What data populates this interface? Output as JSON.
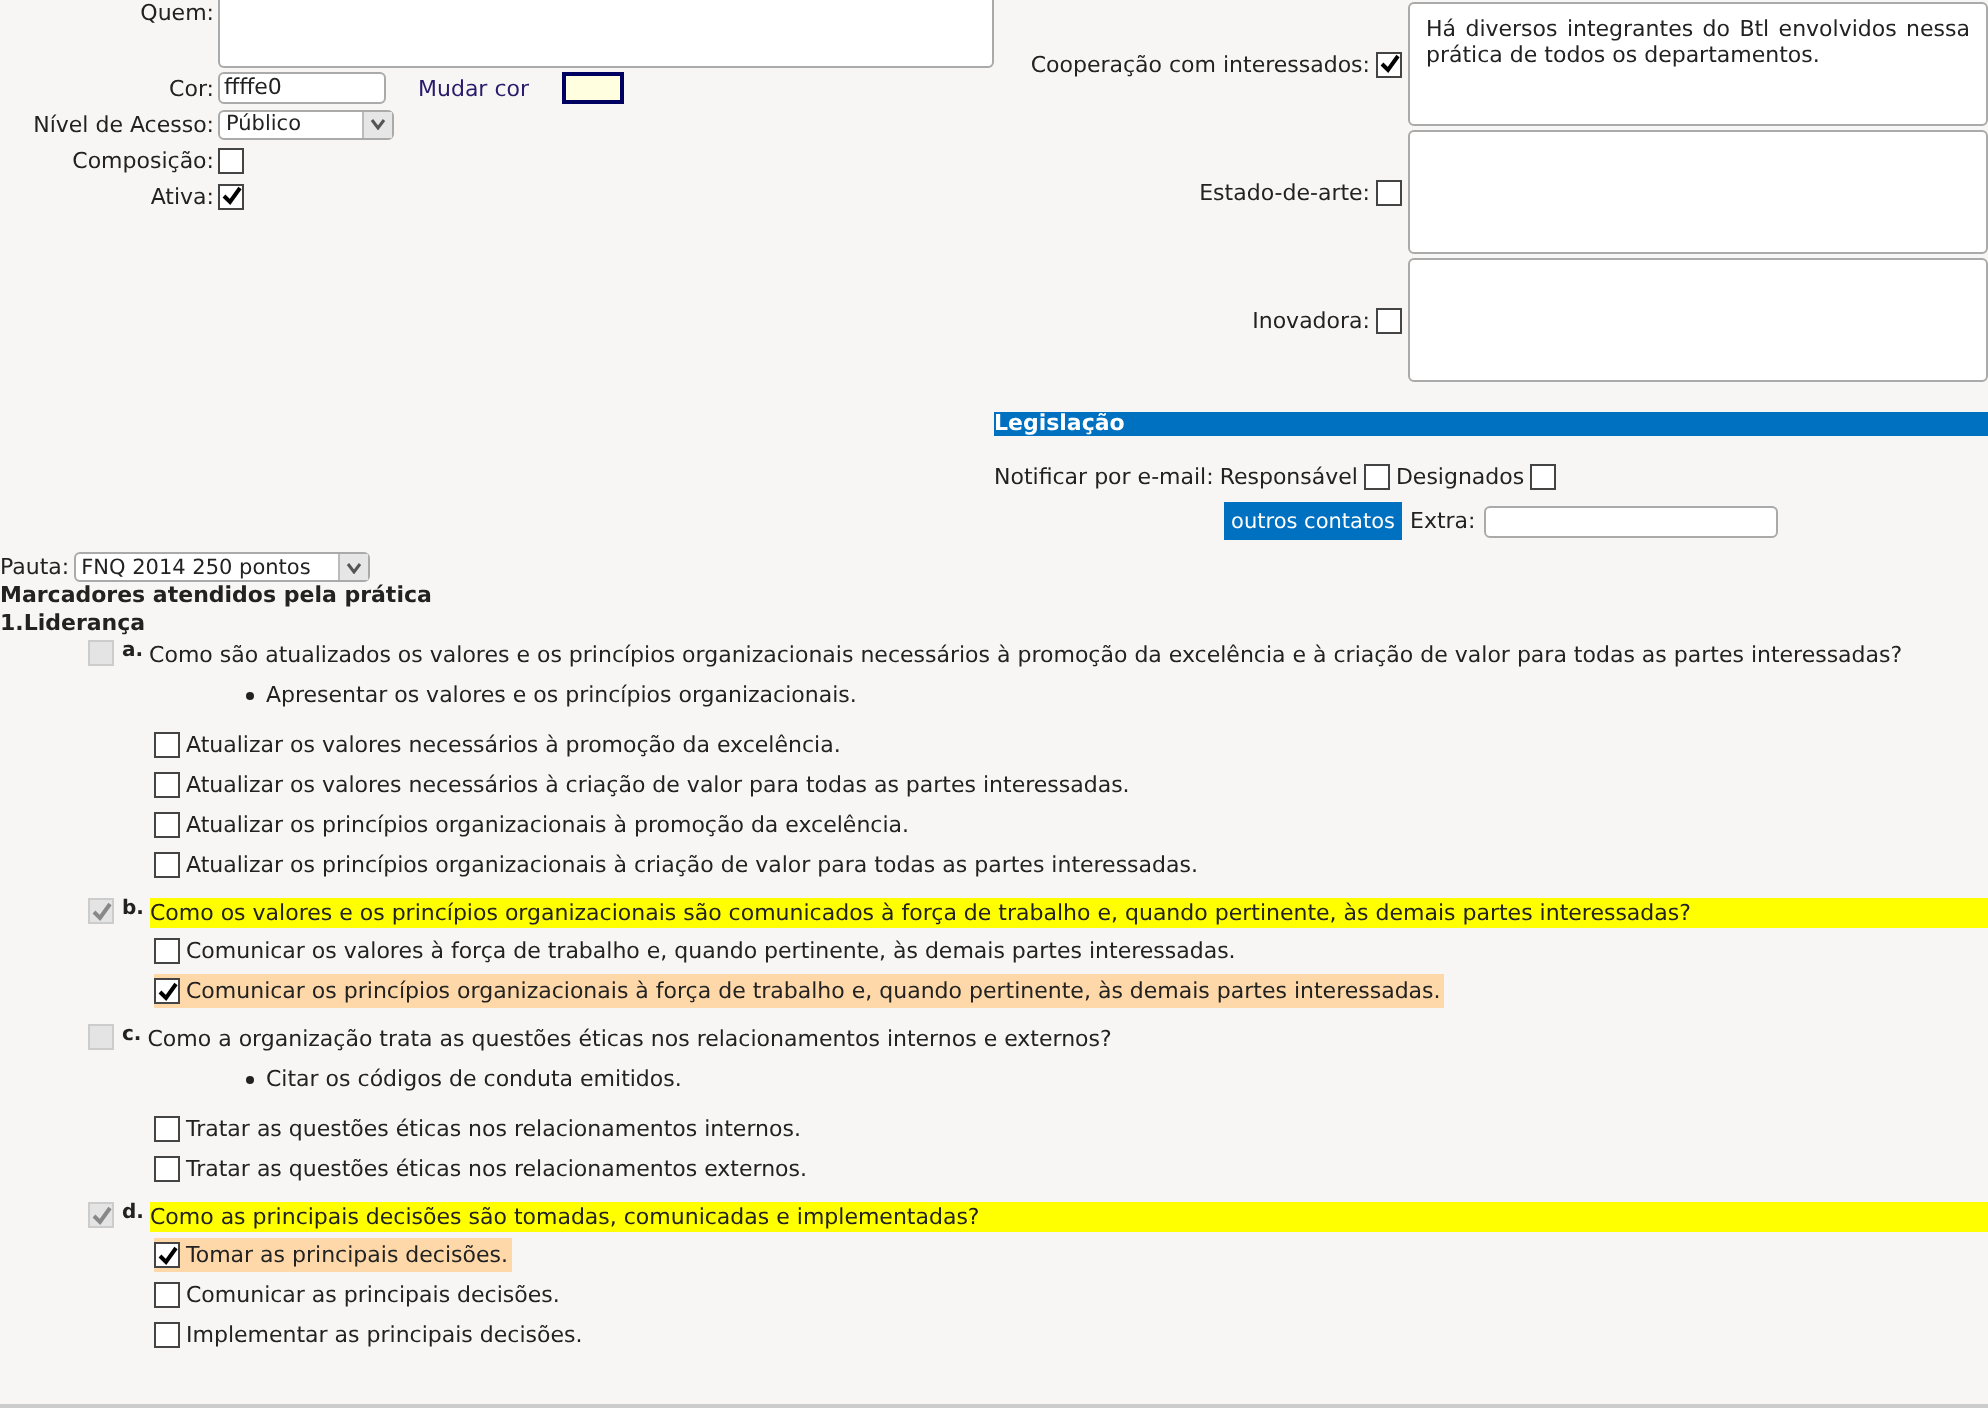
{
  "quem": {
    "label": "Quem:"
  },
  "cor": {
    "label": "Cor:",
    "value": "ffffe0",
    "change_label": "Mudar cor"
  },
  "nivel": {
    "label": "Nível de Acesso:",
    "value": "Público"
  },
  "composicao": {
    "label": "Composição:",
    "checked": false
  },
  "ativa": {
    "label": "Ativa:",
    "checked": true
  },
  "criteria": [
    {
      "label": "Cooperação com interessados:",
      "checked": true,
      "text": "Há diversos integrantes do Btl envolvidos nessa prática de todos os departamentos."
    },
    {
      "label": "Estado-de-arte:",
      "checked": false
    },
    {
      "label": "Inovadora:",
      "checked": false
    }
  ],
  "legislacao": {
    "title": "Legislação",
    "notify_label": "Notificar por e-mail:",
    "options": [
      {
        "label": "Responsável",
        "checked": false
      },
      {
        "label": "Designados",
        "checked": false
      }
    ],
    "button": "outros contatos",
    "extra_label": "Extra:"
  },
  "pauta": {
    "label": "Pauta:",
    "value": "FNQ 2014 250 pontos"
  },
  "markers_title": "Marcadores atendidos pela prática",
  "section_title": "1.Liderança",
  "questions": [
    {
      "letter": "a.",
      "checked": false,
      "text": "Como são atualizados os valores e os princípios organizacionais necessários à promoção da excelência e à criação de valor para todas as partes interessadas?",
      "hints": [
        "Apresentar os valores e os princípios organizacionais."
      ],
      "options": [
        {
          "text": "Atualizar os valores necessários à promoção da excelência.",
          "checked": false
        },
        {
          "text": "Atualizar os valores necessários à criação de valor para todas as partes interessadas.",
          "checked": false
        },
        {
          "text": "Atualizar os princípios organizacionais à promoção da excelência.",
          "checked": false
        },
        {
          "text": "Atualizar os princípios organizacionais à criação de valor para todas as partes interessadas.",
          "checked": false
        }
      ]
    },
    {
      "letter": "b.",
      "checked": true,
      "text": "Como os valores e os princípios organizacionais são comunicados à força de trabalho e, quando pertinente, às demais partes interessadas?",
      "options": [
        {
          "text": "Comunicar os valores à força de trabalho e, quando pertinente, às demais partes interessadas.",
          "checked": false
        },
        {
          "text": "Comunicar os princípios organizacionais à força de trabalho e, quando pertinente, às demais partes interessadas.",
          "checked": true
        }
      ]
    },
    {
      "letter": "c.",
      "checked": false,
      "text": "Como a organização trata as questões éticas nos relacionamentos internos e externos?",
      "hints": [
        "Citar os códigos de conduta emitidos."
      ],
      "options": [
        {
          "text": "Tratar as questões éticas nos relacionamentos internos.",
          "checked": false
        },
        {
          "text": "Tratar as questões éticas nos relacionamentos externos.",
          "checked": false
        }
      ]
    },
    {
      "letter": "d.",
      "checked": true,
      "text": "Como as principais decisões são tomadas, comunicadas e implementadas?",
      "options": [
        {
          "text": "Tomar as principais decisões.",
          "checked": true
        },
        {
          "text": "Comunicar as principais decisões.",
          "checked": false
        },
        {
          "text": "Implementar as principais decisões.",
          "checked": false
        }
      ]
    }
  ]
}
